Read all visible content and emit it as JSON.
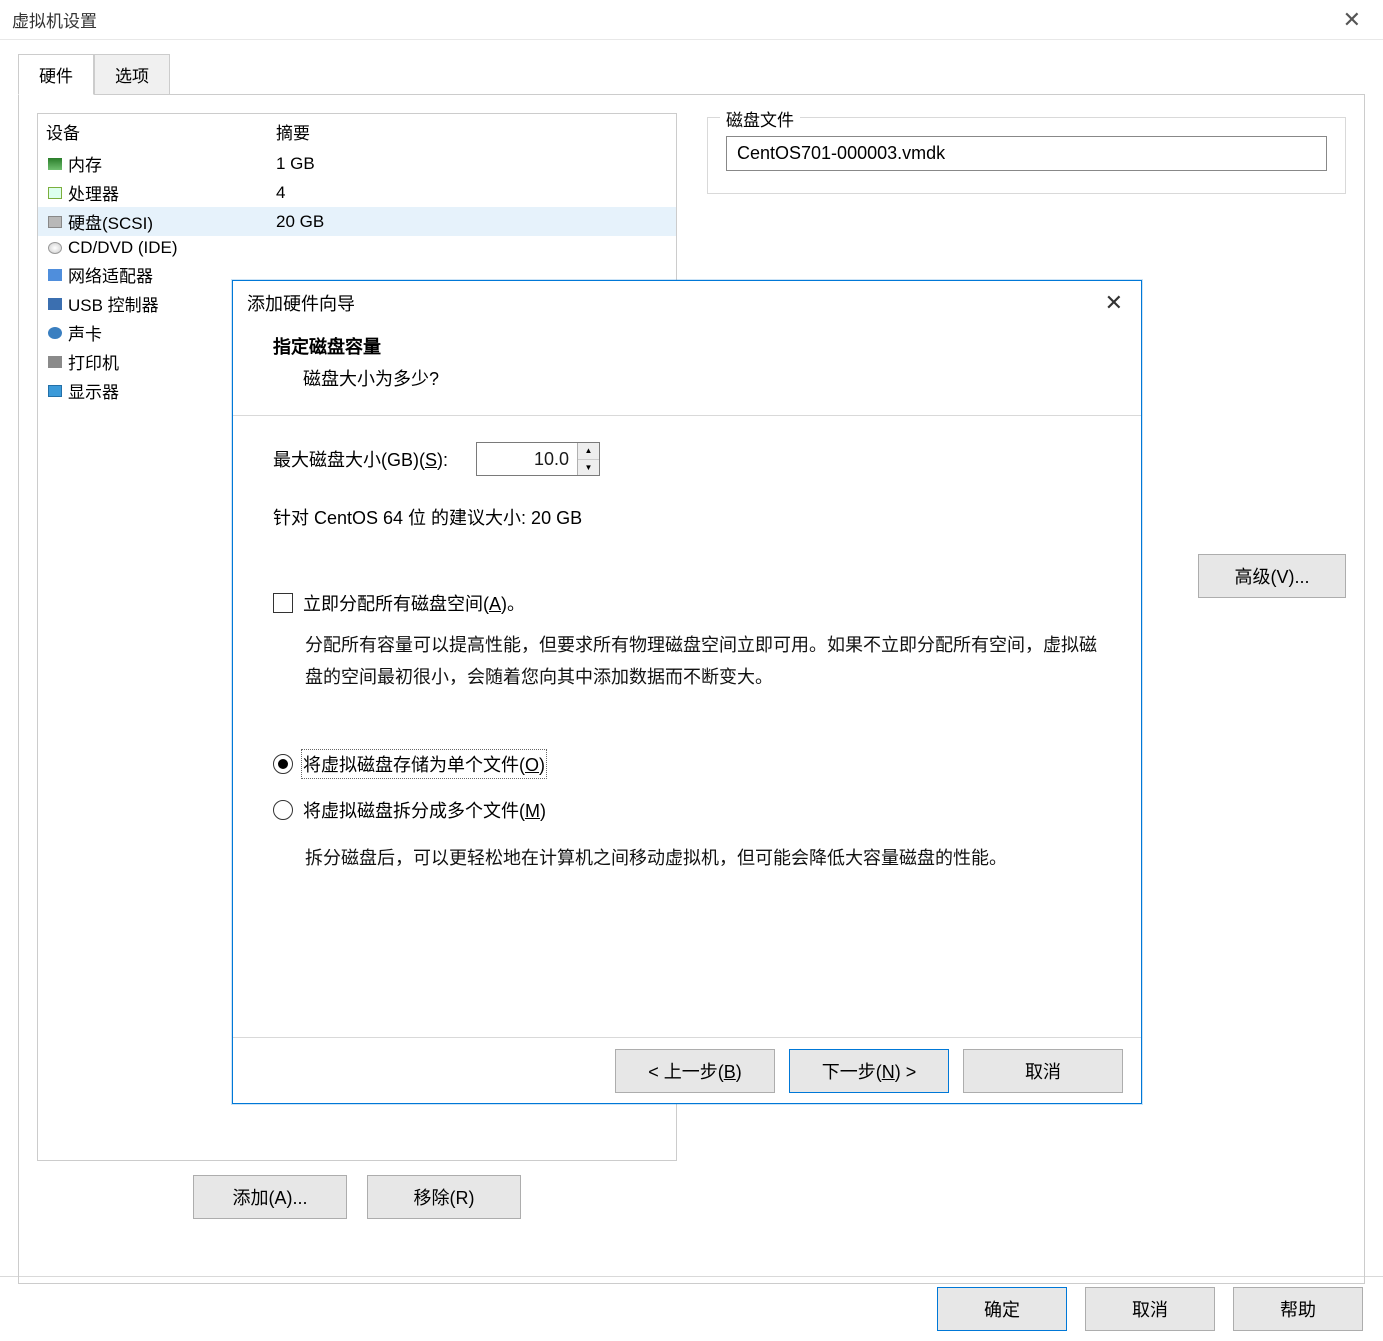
{
  "window": {
    "title": "虚拟机设置"
  },
  "tabs": {
    "hardware": "硬件",
    "options": "选项"
  },
  "deviceList": {
    "header": {
      "name": "设备",
      "summary": "摘要"
    },
    "rows": [
      {
        "name": "内存",
        "summary": "1 GB",
        "icon": "ic-mem"
      },
      {
        "name": "处理器",
        "summary": "4",
        "icon": "ic-cpu"
      },
      {
        "name": "硬盘(SCSI)",
        "summary": "20 GB",
        "icon": "ic-hd",
        "selected": true
      },
      {
        "name": "CD/DVD (IDE)",
        "summary": "",
        "icon": "ic-cd"
      },
      {
        "name": "网络适配器",
        "summary": "",
        "icon": "ic-net"
      },
      {
        "name": "USB 控制器",
        "summary": "",
        "icon": "ic-usb"
      },
      {
        "name": "声卡",
        "summary": "",
        "icon": "ic-snd"
      },
      {
        "name": "打印机",
        "summary": "",
        "icon": "ic-prn"
      },
      {
        "name": "显示器",
        "summary": "",
        "icon": "ic-mon"
      }
    ]
  },
  "leftButtons": {
    "add": "添加(A)...",
    "remove": "移除(R)"
  },
  "rightPanel": {
    "diskFileLegend": "磁盘文件",
    "diskFileValue": "CentOS701-000003.vmdk",
    "advanced": "高级(V)..."
  },
  "footer": {
    "ok": "确定",
    "cancel": "取消",
    "help": "帮助"
  },
  "wizard": {
    "title": "添加硬件向导",
    "heading": "指定磁盘容量",
    "sub": "磁盘大小为多少?",
    "maxSizeLabelPrefix": "最大磁盘大小(GB)(",
    "maxSizeKey": "S",
    "maxSizeLabelSuffix": "):",
    "maxSizeValue": "10.0",
    "recommend": "针对 CentOS 64 位 的建议大小: 20 GB",
    "allocNowPrefix": "立即分配所有磁盘空间(",
    "allocNowKey": "A",
    "allocNowSuffix": ")。",
    "allocDesc": "分配所有容量可以提高性能，但要求所有物理磁盘空间立即可用。如果不立即分配所有空间，虚拟磁盘的空间最初很小，会随着您向其中添加数据而不断变大。",
    "radioSinglePrefix": "将虚拟磁盘存储为单个文件(",
    "radioSingleKey": "O",
    "radioSingleSuffix": ")",
    "radioSplitPrefix": "将虚拟磁盘拆分成多个文件(",
    "radioSplitKey": "M",
    "radioSplitSuffix": ")",
    "splitDesc": "拆分磁盘后，可以更轻松地在计算机之间移动虚拟机，但可能会降低大容量磁盘的性能。",
    "back": "< 上一步(",
    "backKey": "B",
    "backSuffix": ")",
    "next": "下一步(",
    "nextKey": "N",
    "nextSuffix": ") >",
    "cancel": "取消"
  }
}
